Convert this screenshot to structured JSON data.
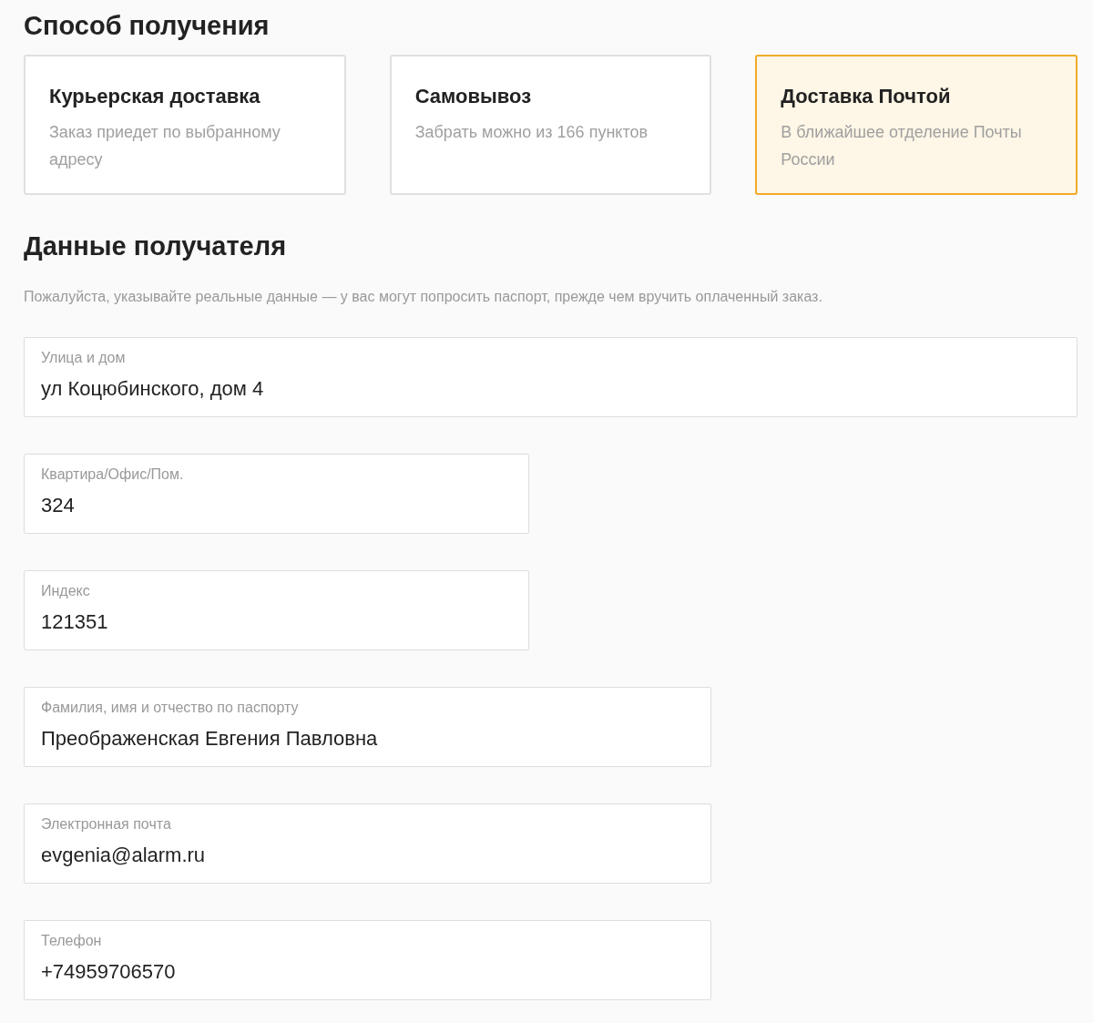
{
  "delivery": {
    "title": "Способ получения",
    "options": [
      {
        "title": "Курьерская доставка",
        "description": "Заказ приедет по выбранному адресу",
        "selected": false
      },
      {
        "title": "Самовывоз",
        "description": "Забрать можно из 166 пунктов",
        "selected": false
      },
      {
        "title": "Доставка Почтой",
        "description": "В ближайшее отделение Почты России",
        "selected": true
      }
    ]
  },
  "recipient": {
    "title": "Данные получателя",
    "notice": "Пожалуйста, указывайте реальные данные — у вас могут попросить паспорт, прежде чем вручить оплаченный заказ.",
    "fields": [
      {
        "kind": "wide",
        "label": "Улица и дом",
        "value": "ул Коцюбинского, дом 4"
      },
      {
        "kind": "short",
        "label": "Квартира/Офис/Пом.",
        "value": "324"
      },
      {
        "kind": "short",
        "label": "Индекс",
        "value": "121351"
      },
      {
        "kind": "medium",
        "label": "Фамилия, имя и отчество по паспорту",
        "value": "Преображенская Евгения Павловна"
      },
      {
        "kind": "medium",
        "label": "Электронная почта",
        "value": "evgenia@alarm.ru"
      },
      {
        "kind": "medium",
        "label": "Телефон",
        "value": "+74959706570"
      }
    ]
  }
}
